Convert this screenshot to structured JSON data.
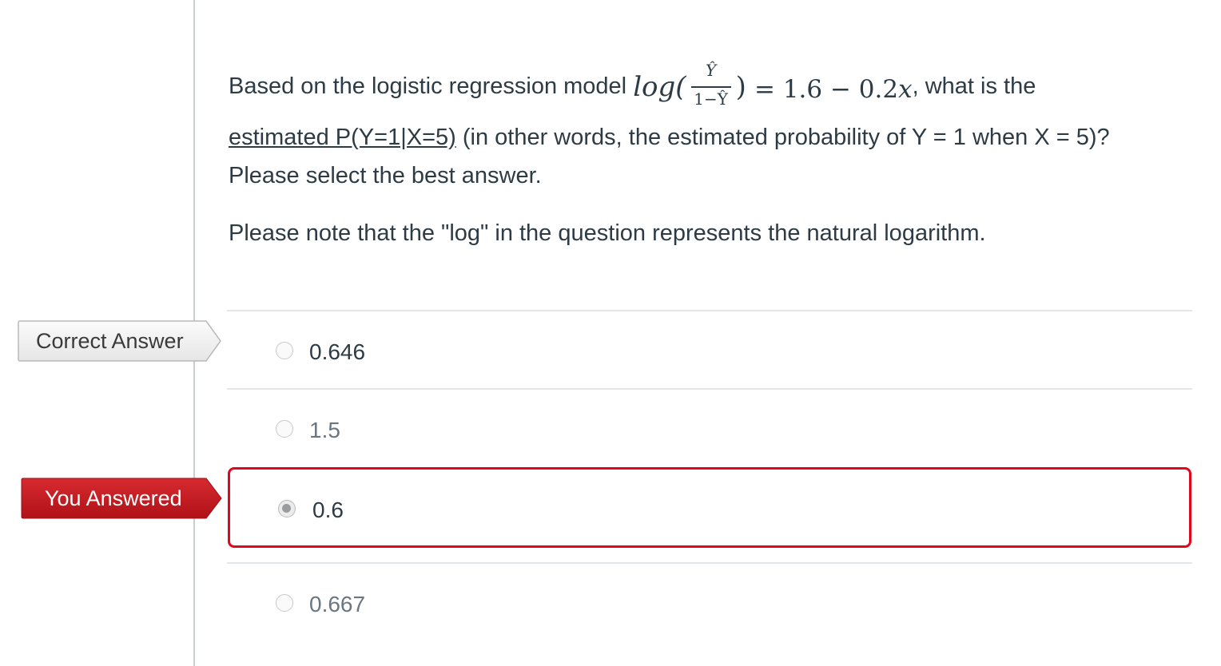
{
  "question": {
    "line1_prefix": "Based on the logistic regression model",
    "math_log": "log(",
    "math_numerator": "Ŷ",
    "math_denominator": "1−Ŷ",
    "math_close": ")",
    "math_rhs": "= 1.6 − 0.2",
    "math_var": "x",
    "line1_suffix": ", what is the",
    "line2_underlined": "estimated P(Y=1|X=5)",
    "line2_rest": " (in other words, the estimated probability of Y = 1 when X = 5)?",
    "line3": "Please select the best answer.",
    "note": "Please note that the \"log\" in the question represents the natural logarithm."
  },
  "flags": {
    "correct_label": "Correct Answer",
    "you_label": "You Answered",
    "correct_color": "#f3f3f3",
    "you_color": "#c4161c"
  },
  "answers": [
    {
      "label": "0.646",
      "status": "correct",
      "selected": false
    },
    {
      "label": "1.5",
      "status": "neutral",
      "selected": false
    },
    {
      "label": "0.6",
      "status": "you-answered",
      "selected": true
    },
    {
      "label": "0.667",
      "status": "neutral",
      "selected": false
    }
  ],
  "colors": {
    "selected_border": "#e0081c",
    "text": "#2d3b45"
  }
}
